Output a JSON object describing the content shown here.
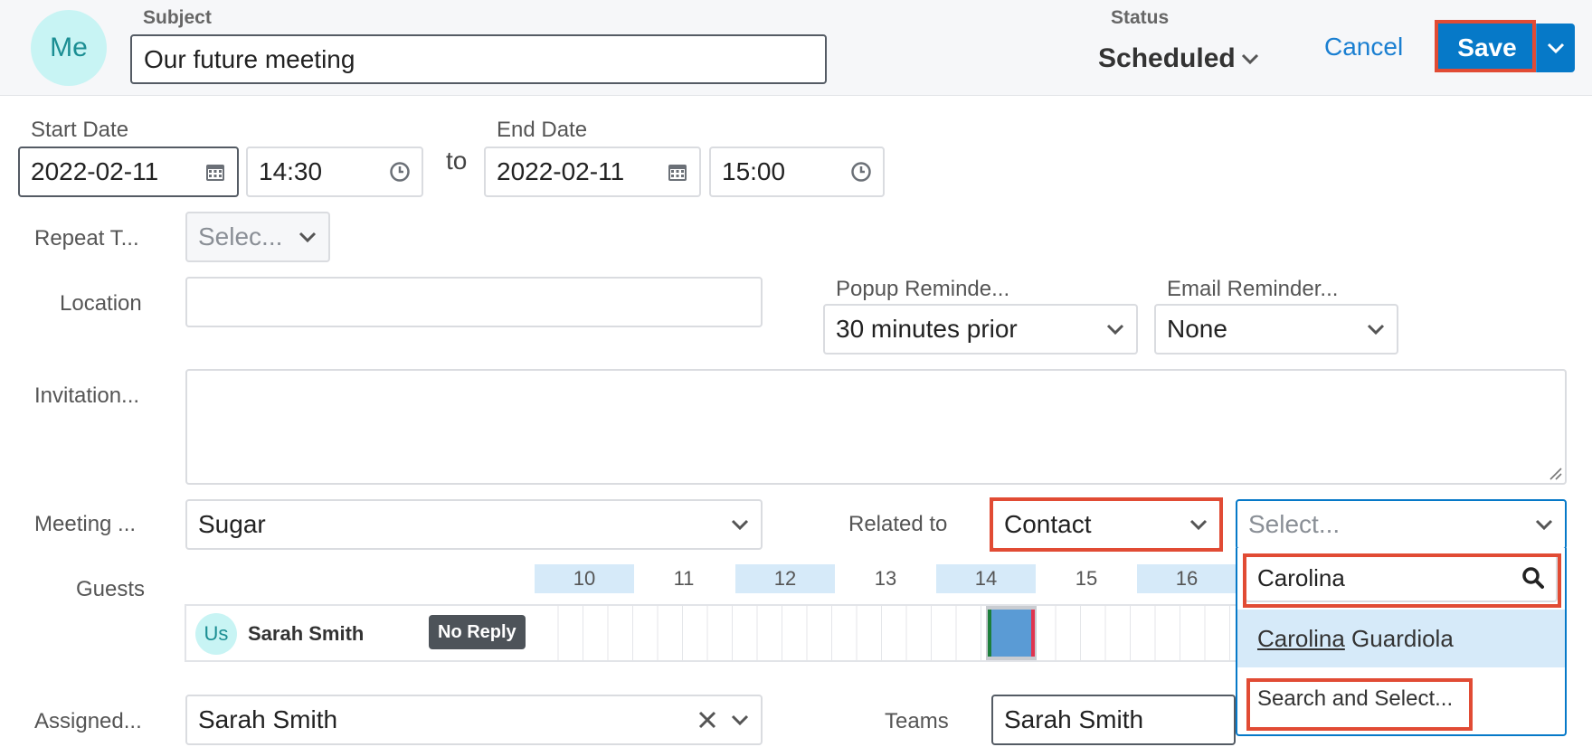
{
  "header": {
    "avatar_initials": "Me",
    "subject_label": "Subject",
    "subject_value": "Our future meeting",
    "status_label": "Status",
    "status_value": "Scheduled",
    "cancel_label": "Cancel",
    "save_label": "Save"
  },
  "dates": {
    "start_label": "Start Date",
    "start_date": "2022-02-11",
    "start_time": "14:30",
    "to_label": "to",
    "end_label": "End Date",
    "end_date": "2022-02-11",
    "end_time": "15:00"
  },
  "repeat": {
    "label": "Repeat T...",
    "placeholder": "Selec..."
  },
  "location": {
    "label": "Location",
    "value": ""
  },
  "popup_reminder": {
    "label": "Popup Reminde...",
    "value": "30 minutes prior"
  },
  "email_reminder": {
    "label": "Email Reminder...",
    "value": "None"
  },
  "invitation": {
    "label": "Invitation...",
    "value": ""
  },
  "meeting_type": {
    "label": "Meeting ...",
    "value": "Sugar"
  },
  "related_to": {
    "label": "Related to",
    "module_value": "Contact",
    "record_placeholder": "Select...",
    "search_value": "Carolina",
    "result_match": "Carolina",
    "result_rest": " Guardiola",
    "search_and_select": "Search and Select..."
  },
  "guests": {
    "label": "Guests",
    "hours": [
      "10",
      "11",
      "12",
      "13",
      "14",
      "15",
      "16"
    ],
    "guest_initials": "Us",
    "guest_name": "Sarah Smith",
    "guest_status": "No Reply"
  },
  "assigned": {
    "label": "Assigned...",
    "value": "Sarah Smith"
  },
  "teams": {
    "label": "Teams",
    "value": "Sarah Smith"
  },
  "colors": {
    "accent": "#0679c8",
    "highlight": "#e14b34",
    "avatar_bg": "#c8f4f4",
    "busy_block": "#5a9bd5",
    "hour_shade": "#d6eaf9"
  }
}
